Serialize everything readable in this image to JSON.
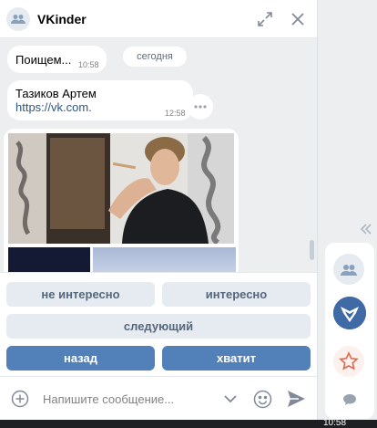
{
  "header": {
    "title": "VKinder"
  },
  "messages": [
    {
      "text": "Поищем...",
      "time": "10:58"
    },
    {
      "text": "Тазиков Артем",
      "link": "https://vk.com.",
      "time": "12:58"
    }
  ],
  "date_separator": "сегодня",
  "keyboard": {
    "not_interested": "не интересно",
    "interested": "интересно",
    "next": "следующий",
    "back": "назад",
    "enough": "хватит"
  },
  "composer": {
    "placeholder": "Напишите сообщение..."
  },
  "taskbar": {
    "clock": "10:58"
  },
  "colors": {
    "accent": "#5181b8",
    "secondary_btn": "#e5ebf1",
    "link": "#2a5885"
  },
  "icons": [
    "group-avatar-icon",
    "expand-icon",
    "close-icon",
    "more-icon",
    "attach-plus-icon",
    "chevron-down-icon",
    "emoji-icon",
    "send-icon",
    "double-chevron-left-icon",
    "group-icon",
    "vk-app-icon",
    "star-icon",
    "chat-bubble-icon"
  ]
}
